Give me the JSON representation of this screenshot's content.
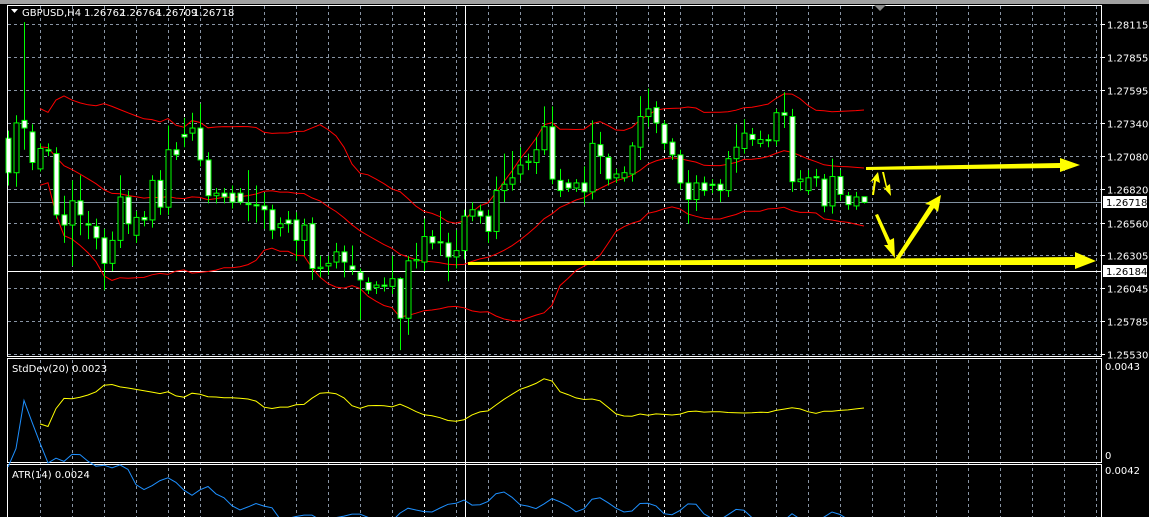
{
  "header": {
    "symbol": "GBPUSD,H4",
    "open": "1.26762",
    "high": "1.26764",
    "low": "1.26709",
    "close": "1.26718"
  },
  "colors": {
    "background": "#000000",
    "candle": "#00ff00",
    "bear_body": "#ffffff",
    "bands": "#ff0000",
    "stddev": "#ffff00",
    "atr": "#1e90ff",
    "annotation": "#ffff00",
    "grid": "#8894a4"
  },
  "price_axis": {
    "labels": [
      "1.28115",
      "1.27855",
      "1.27595",
      "1.27340",
      "1.27080",
      "1.26820",
      "1.26560",
      "1.26305",
      "1.26045",
      "1.25785",
      "1.25530"
    ],
    "bid_marker": "1.26718",
    "crosshair_marker": "1.26184"
  },
  "stddev_pane": {
    "label": "StdDev(20) 0.0023",
    "axis_top": "0.0043",
    "axis_bottom": "0"
  },
  "atr_pane": {
    "label": "ATR(14) 0.0024",
    "axis_top": "0.0042"
  },
  "chart_data": {
    "type": "candlestick",
    "symbol": "GBPUSD",
    "timeframe": "H4",
    "ylim": [
      1.2553,
      1.28115
    ],
    "indicators": [
      "Bollinger Bands(20,2)",
      "StdDev(20)",
      "ATR(14)"
    ],
    "ohlc": [
      [
        1.2722,
        1.2728,
        1.2685,
        1.2695
      ],
      [
        1.2695,
        1.274,
        1.2684,
        1.2734
      ],
      [
        1.2736,
        1.2813,
        1.2713,
        1.273
      ],
      [
        1.2727,
        1.2733,
        1.2697,
        1.2703
      ],
      [
        1.2698,
        1.2718,
        1.2696,
        1.2714
      ],
      [
        1.2713,
        1.2718,
        1.2708,
        1.2712
      ],
      [
        1.271,
        1.2715,
        1.2659,
        1.2662
      ],
      [
        1.2662,
        1.2677,
        1.264,
        1.2654
      ],
      [
        1.2654,
        1.2689,
        1.2622,
        1.2673
      ],
      [
        1.2673,
        1.2693,
        1.2646,
        1.2662
      ],
      [
        1.2655,
        1.2665,
        1.2643,
        1.2654
      ],
      [
        1.2653,
        1.2659,
        1.2635,
        1.2644
      ],
      [
        1.2644,
        1.2651,
        1.2603,
        1.2624
      ],
      [
        1.2624,
        1.2649,
        1.2618,
        1.2642
      ],
      [
        1.2642,
        1.2693,
        1.2636,
        1.2676
      ],
      [
        1.2676,
        1.2681,
        1.2647,
        1.2655
      ],
      [
        1.2646,
        1.2665,
        1.264,
        1.266
      ],
      [
        1.266,
        1.2665,
        1.2653,
        1.2658
      ],
      [
        1.2658,
        1.2693,
        1.2652,
        1.2689
      ],
      [
        1.2689,
        1.2697,
        1.2662,
        1.2668
      ],
      [
        1.2668,
        1.2732,
        1.2662,
        1.2713
      ],
      [
        1.2713,
        1.2719,
        1.2705,
        1.2709
      ],
      [
        1.2725,
        1.2738,
        1.2715,
        1.2723
      ],
      [
        1.2726,
        1.2742,
        1.272,
        1.273
      ],
      [
        1.273,
        1.2749,
        1.27,
        1.2705
      ],
      [
        1.2705,
        1.2711,
        1.2671,
        1.2677
      ],
      [
        1.2677,
        1.2683,
        1.2671,
        1.2679
      ],
      [
        1.2679,
        1.2683,
        1.2671,
        1.2676
      ],
      [
        1.2679,
        1.2685,
        1.2667,
        1.2672
      ],
      [
        1.2679,
        1.2683,
        1.267,
        1.2672
      ],
      [
        1.2671,
        1.2697,
        1.2657,
        1.267
      ],
      [
        1.267,
        1.2685,
        1.2656,
        1.2669
      ],
      [
        1.2669,
        1.2679,
        1.2651,
        1.2666
      ],
      [
        1.2666,
        1.267,
        1.2643,
        1.265
      ],
      [
        1.2652,
        1.266,
        1.2645,
        1.2655
      ],
      [
        1.2658,
        1.2665,
        1.2648,
        1.2655
      ],
      [
        1.2658,
        1.2664,
        1.2626,
        1.2642
      ],
      [
        1.2642,
        1.2659,
        1.263,
        1.2654
      ],
      [
        1.2655,
        1.266,
        1.2611,
        1.262
      ],
      [
        1.262,
        1.263,
        1.2613,
        1.2621
      ],
      [
        1.2622,
        1.263,
        1.2615,
        1.2624
      ],
      [
        1.2625,
        1.264,
        1.262,
        1.2633
      ],
      [
        1.2633,
        1.2638,
        1.2613,
        1.2625
      ],
      [
        1.2622,
        1.2638,
        1.2615,
        1.2619
      ],
      [
        1.2617,
        1.262,
        1.258,
        1.2611
      ],
      [
        1.2609,
        1.2613,
        1.26,
        1.2603
      ],
      [
        1.2605,
        1.261,
        1.26,
        1.2607
      ],
      [
        1.2607,
        1.2613,
        1.2602,
        1.2606
      ],
      [
        1.2606,
        1.263,
        1.26,
        1.2612
      ],
      [
        1.2612,
        1.2613,
        1.2556,
        1.2581
      ],
      [
        1.2581,
        1.263,
        1.2568,
        1.2626
      ],
      [
        1.2626,
        1.264,
        1.262,
        1.2627
      ],
      [
        1.2625,
        1.2659,
        1.2618,
        1.2645
      ],
      [
        1.2645,
        1.265,
        1.2635,
        1.264
      ],
      [
        1.2641,
        1.2665,
        1.263,
        1.264
      ],
      [
        1.264,
        1.2648,
        1.261,
        1.2629
      ],
      [
        1.2629,
        1.265,
        1.262,
        1.2634
      ],
      [
        1.2634,
        1.2666,
        1.2627,
        1.2661
      ],
      [
        1.2661,
        1.2672,
        1.2657,
        1.2666
      ],
      [
        1.2665,
        1.267,
        1.2655,
        1.2661
      ],
      [
        1.2661,
        1.2666,
        1.264,
        1.2649
      ],
      [
        1.2649,
        1.2692,
        1.2643,
        1.2681
      ],
      [
        1.2681,
        1.271,
        1.2672,
        1.2686
      ],
      [
        1.2686,
        1.2712,
        1.2681,
        1.2691
      ],
      [
        1.2694,
        1.2715,
        1.2689,
        1.2701
      ],
      [
        1.2703,
        1.271,
        1.2697,
        1.2704
      ],
      [
        1.2703,
        1.2723,
        1.2694,
        1.2713
      ],
      [
        1.2713,
        1.2747,
        1.2709,
        1.2731
      ],
      [
        1.2731,
        1.2747,
        1.2686,
        1.269
      ],
      [
        1.2689,
        1.2698,
        1.2676,
        1.2681
      ],
      [
        1.2687,
        1.269,
        1.268,
        1.2683
      ],
      [
        1.2683,
        1.269,
        1.268,
        1.2687
      ],
      [
        1.2687,
        1.27,
        1.267,
        1.268
      ],
      [
        1.268,
        1.2736,
        1.2674,
        1.2718
      ],
      [
        1.2717,
        1.2727,
        1.2694,
        1.2708
      ],
      [
        1.2707,
        1.271,
        1.2685,
        1.269
      ],
      [
        1.2691,
        1.2698,
        1.2687,
        1.2694
      ],
      [
        1.2691,
        1.27,
        1.2688,
        1.2695
      ],
      [
        1.2694,
        1.2719,
        1.2688,
        1.2716
      ],
      [
        1.2715,
        1.2755,
        1.2705,
        1.2739
      ],
      [
        1.2739,
        1.2761,
        1.2731,
        1.2745
      ],
      [
        1.2746,
        1.2751,
        1.2726,
        1.2734
      ],
      [
        1.2733,
        1.2736,
        1.2713,
        1.2718
      ],
      [
        1.2719,
        1.2722,
        1.2705,
        1.2709
      ],
      [
        1.2709,
        1.2713,
        1.2682,
        1.2687
      ],
      [
        1.2687,
        1.2697,
        1.2655,
        1.2674
      ],
      [
        1.2674,
        1.2693,
        1.2665,
        1.2687
      ],
      [
        1.2687,
        1.2692,
        1.2677,
        1.2681
      ],
      [
        1.2686,
        1.269,
        1.2679,
        1.2685
      ],
      [
        1.2686,
        1.269,
        1.2672,
        1.2681
      ],
      [
        1.2681,
        1.2712,
        1.2676,
        1.2706
      ],
      [
        1.2706,
        1.2733,
        1.2695,
        1.2715
      ],
      [
        1.2714,
        1.2737,
        1.271,
        1.2726
      ],
      [
        1.2725,
        1.273,
        1.2716,
        1.2721
      ],
      [
        1.2718,
        1.2728,
        1.2715,
        1.2721
      ],
      [
        1.2721,
        1.2725,
        1.2715,
        1.272
      ],
      [
        1.272,
        1.2745,
        1.2716,
        1.2742
      ],
      [
        1.2742,
        1.2758,
        1.273,
        1.274
      ],
      [
        1.2739,
        1.2745,
        1.268,
        1.2688
      ],
      [
        1.2688,
        1.2697,
        1.2681,
        1.269
      ],
      [
        1.2681,
        1.2697,
        1.2678,
        1.2691
      ],
      [
        1.2692,
        1.2698,
        1.2684,
        1.2691
      ],
      [
        1.269,
        1.2694,
        1.2664,
        1.2669
      ],
      [
        1.2669,
        1.2706,
        1.2663,
        1.2692
      ],
      [
        1.2692,
        1.2697,
        1.2673,
        1.2678
      ],
      [
        1.2677,
        1.268,
        1.2666,
        1.267
      ],
      [
        1.2669,
        1.268,
        1.2666,
        1.2676
      ],
      [
        1.26762,
        1.26764,
        1.26709,
        1.26718
      ]
    ]
  }
}
